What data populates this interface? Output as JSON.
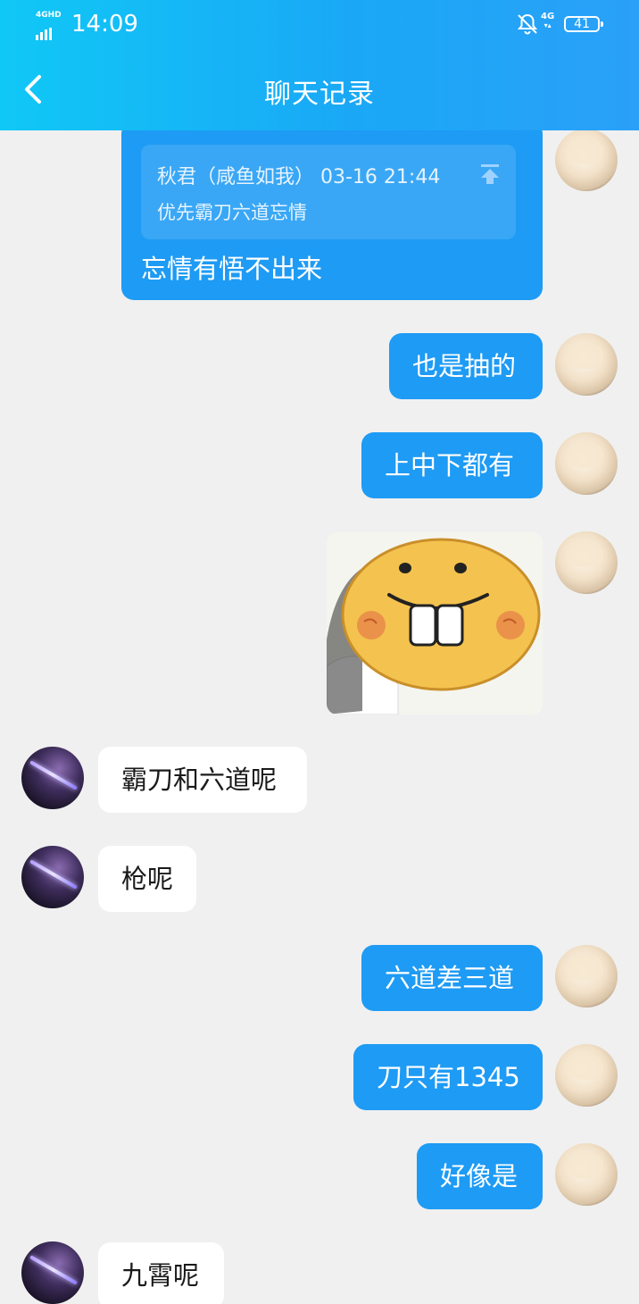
{
  "status_bar": {
    "network_left": "4GHD",
    "time": "14:09",
    "network_right": "4G",
    "battery": "41"
  },
  "header": {
    "title": "聊天记录"
  },
  "messages": {
    "quote": {
      "meta": "秋君（咸鱼如我） 03-16 21:44",
      "quoted_text": "优先霸刀六道忘情",
      "reply_text": "忘情有悟不出来"
    },
    "m1": "也是抽的",
    "m2": "上中下都有",
    "m3": "霸刀和六道呢",
    "m4": "枪呢",
    "m5": "六道差三道",
    "m6": "刀只有1345",
    "m7": "好像是",
    "m8": "九霄呢"
  }
}
